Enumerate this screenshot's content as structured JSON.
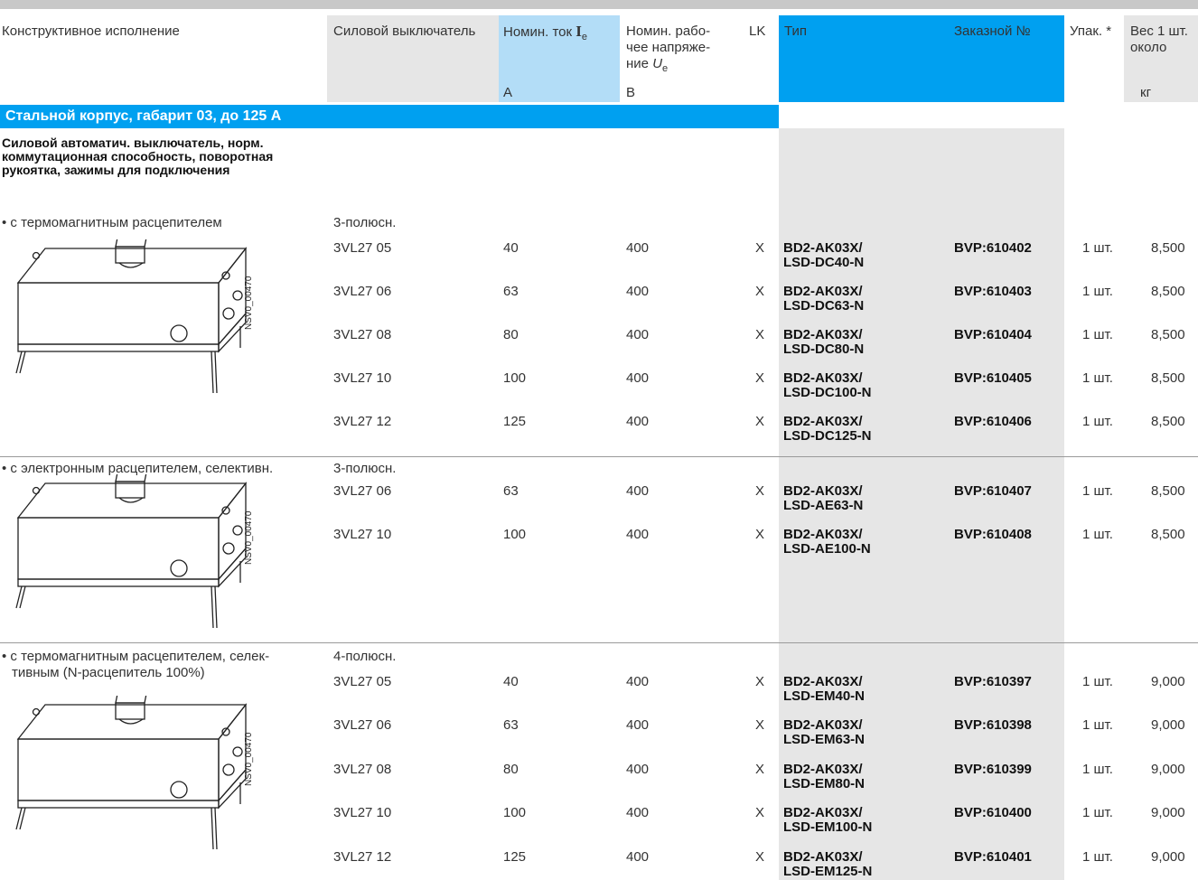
{
  "header": {
    "col_design": "Конструктивное исполнение",
    "col_breaker": "Силовой выключатель",
    "col_current": "Номин. ток",
    "col_current_sym": "I",
    "col_current_sub": "e",
    "col_voltage_l1": "Номин. рабо-",
    "col_voltage_l2": "чее напряже-",
    "col_voltage_l3": "ние",
    "col_voltage_sym": "U",
    "col_voltage_sub": "e",
    "col_lk": "LK",
    "col_type": "Тип",
    "col_order": "Заказной №",
    "col_pack": "Упак. *",
    "col_weight_l1": "Вес 1 шт.",
    "col_weight_l2": "около",
    "unit_current": "А",
    "unit_voltage": "В",
    "unit_weight": "кг"
  },
  "section_title": "Стальной корпус, габарит 03, до 125 А",
  "subheading": "Силовой автоматич. выключатель, норм. коммутационная способность, поворотная рукоятка, зажимы для подключения",
  "image_code": "NSV0_00470",
  "groups": [
    {
      "label": "• с термомагнитным расцепителем",
      "label2": "",
      "poles": "3-полюсн.",
      "rows": [
        {
          "breaker": "3VL27 05",
          "current": "40",
          "voltage": "400",
          "lk": "X",
          "type1": "BD2-AK03X/",
          "type2": "LSD-DC40-N",
          "order": "BVP:610402",
          "pack": "1 шт.",
          "weight": "8,500"
        },
        {
          "breaker": "3VL27 06",
          "current": "63",
          "voltage": "400",
          "lk": "X",
          "type1": "BD2-AK03X/",
          "type2": "LSD-DC63-N",
          "order": "BVP:610403",
          "pack": "1 шт.",
          "weight": "8,500"
        },
        {
          "breaker": "3VL27 08",
          "current": "80",
          "voltage": "400",
          "lk": "X",
          "type1": "BD2-AK03X/",
          "type2": "LSD-DC80-N",
          "order": "BVP:610404",
          "pack": "1 шт.",
          "weight": "8,500"
        },
        {
          "breaker": "3VL27 10",
          "current": "100",
          "voltage": "400",
          "lk": "X",
          "type1": "BD2-AK03X/",
          "type2": "LSD-DC100-N",
          "order": "BVP:610405",
          "pack": "1 шт.",
          "weight": "8,500"
        },
        {
          "breaker": "3VL27 12",
          "current": "125",
          "voltage": "400",
          "lk": "X",
          "type1": "BD2-AK03X/",
          "type2": "LSD-DC125-N",
          "order": "BVP:610406",
          "pack": "1 шт.",
          "weight": "8,500"
        }
      ]
    },
    {
      "label": "• с электронным расцепителем, селективн.",
      "label2": "",
      "poles": "3-полюсн.",
      "rows": [
        {
          "breaker": "3VL27 06",
          "current": "63",
          "voltage": "400",
          "lk": "X",
          "type1": "BD2-AK03X/",
          "type2": "LSD-AE63-N",
          "order": "BVP:610407",
          "pack": "1 шт.",
          "weight": "8,500"
        },
        {
          "breaker": "3VL27 10",
          "current": "100",
          "voltage": "400",
          "lk": "X",
          "type1": "BD2-AK03X/",
          "type2": "LSD-AE100-N",
          "order": "BVP:610408",
          "pack": "1 шт.",
          "weight": "8,500"
        }
      ]
    },
    {
      "label": "• с термомагнитным расцепителем, селек-",
      "label2": "тивным (N-расцепитель 100%)",
      "poles": "4-полюсн.",
      "rows": [
        {
          "breaker": "3VL27 05",
          "current": "40",
          "voltage": "400",
          "lk": "X",
          "type1": "BD2-AK03X/",
          "type2": "LSD-EM40-N",
          "order": "BVP:610397",
          "pack": "1 шт.",
          "weight": "9,000"
        },
        {
          "breaker": "3VL27 06",
          "current": "63",
          "voltage": "400",
          "lk": "X",
          "type1": "BD2-AK03X/",
          "type2": "LSD-EM63-N",
          "order": "BVP:610398",
          "pack": "1 шт.",
          "weight": "9,000"
        },
        {
          "breaker": "3VL27 08",
          "current": "80",
          "voltage": "400",
          "lk": "X",
          "type1": "BD2-AK03X/",
          "type2": "LSD-EM80-N",
          "order": "BVP:610399",
          "pack": "1 шт.",
          "weight": "9,000"
        },
        {
          "breaker": "3VL27 10",
          "current": "100",
          "voltage": "400",
          "lk": "X",
          "type1": "BD2-AK03X/",
          "type2": "LSD-EM100-N",
          "order": "BVP:610400",
          "pack": "1 шт.",
          "weight": "9,000"
        },
        {
          "breaker": "3VL27 12",
          "current": "125",
          "voltage": "400",
          "lk": "X",
          "type1": "BD2-AK03X/",
          "type2": "LSD-EM125-N",
          "order": "BVP:610401",
          "pack": "1 шт.",
          "weight": "9,000"
        }
      ]
    }
  ]
}
